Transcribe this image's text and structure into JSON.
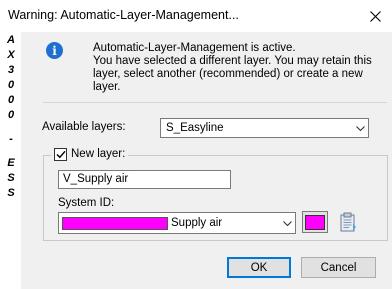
{
  "window": {
    "title": "Warning: Automatic-Layer-Management..."
  },
  "side_text": [
    "A",
    "X",
    "3",
    "0",
    "0",
    "0",
    "-",
    "E",
    "S",
    "S"
  ],
  "message": {
    "lines": [
      "Automatic-Layer-Management is active.",
      "You have selected a different layer. You may retain this",
      "layer, select another (recommended) or create a new",
      "layer."
    ]
  },
  "available_layers": {
    "label": "Available layers:",
    "value": "S_Easyline"
  },
  "new_layer": {
    "checkbox_label": "New layer:",
    "checked": true,
    "value": "V_Supply air"
  },
  "system_id": {
    "label": "System ID:",
    "value": "Supply air",
    "swatch_color": "#ff00ff"
  },
  "buttons": {
    "ok": "OK",
    "cancel": "Cancel"
  },
  "colors": {
    "info_icon": "#1f6fd1",
    "dialog_bg": "#f0f0f0",
    "default_button_border": "#0078d7"
  },
  "icons": {
    "info": "info-icon",
    "close": "close-icon",
    "dropdown": "chevron-down-icon",
    "checkbox": "checkmark-icon",
    "layer_picker": "clipboard-icon"
  }
}
